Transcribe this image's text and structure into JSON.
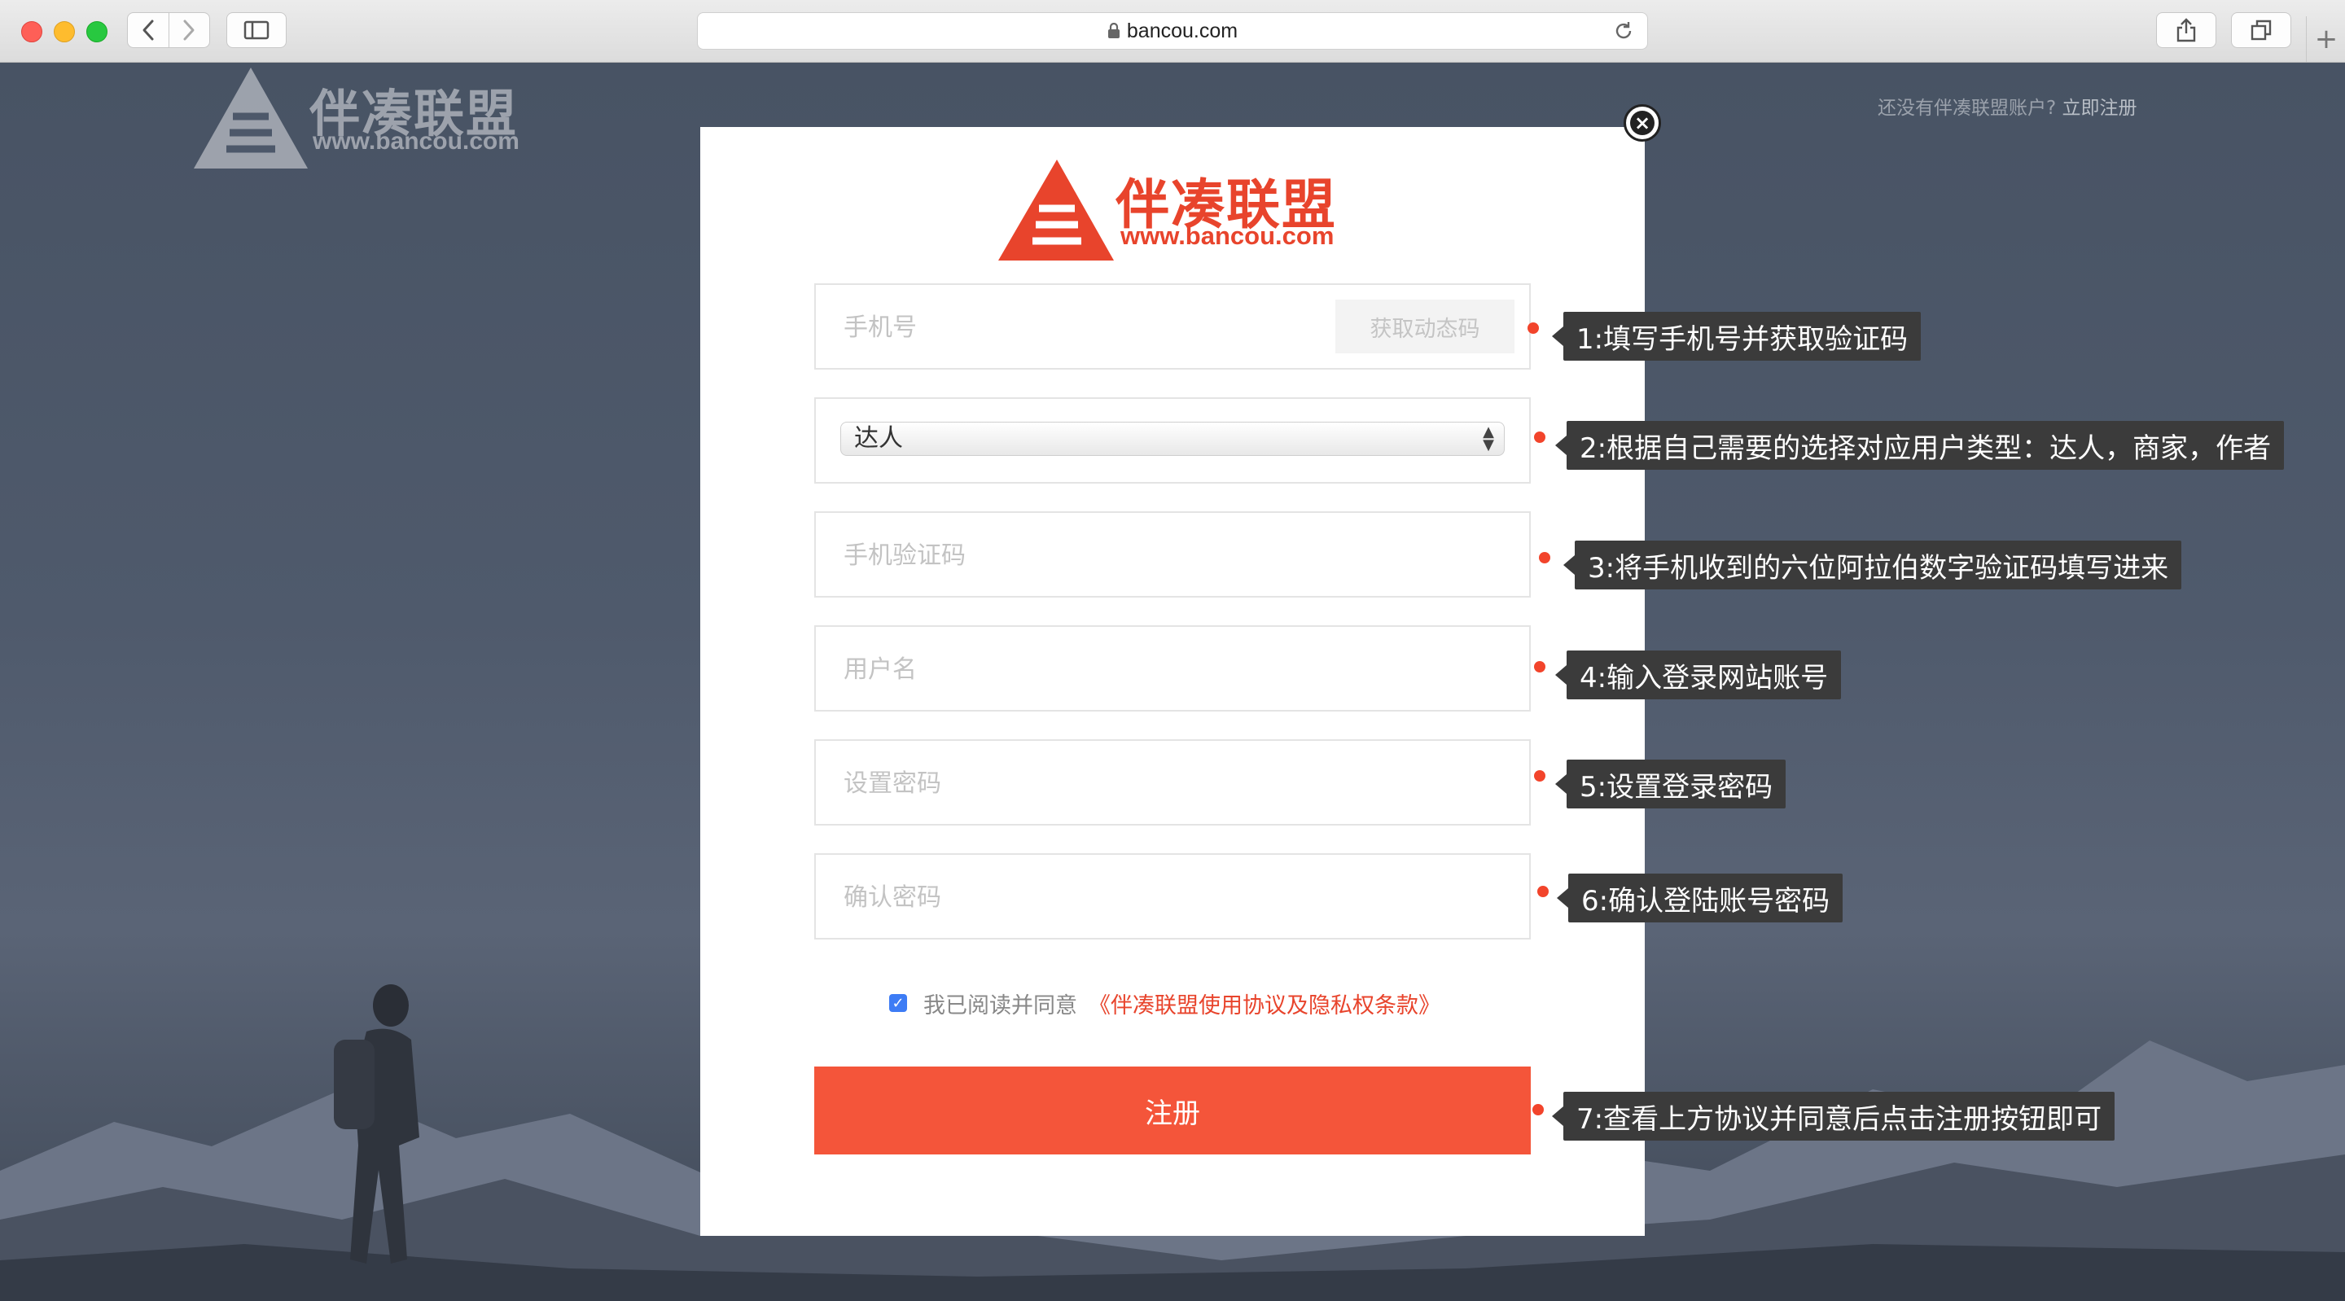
{
  "browser": {
    "url": "bancou.com",
    "icons": {
      "back": "chevron-left-icon",
      "forward": "chevron-right-icon",
      "sidebar": "sidebar-icon",
      "lock": "lock-icon",
      "reload": "reload-icon",
      "share": "share-icon",
      "tabs": "tabs-icon",
      "new_tab": "plus-icon"
    },
    "new_tab_label": "+"
  },
  "background": {
    "logo_text": "伴凑联盟",
    "logo_url": "www.bancou.com",
    "top_link_text": "还没有伴凑联盟账户?",
    "top_link_register": "立即注册"
  },
  "modal": {
    "close_label": "×",
    "logo_text": "伴凑联盟",
    "logo_url": "www.bancou.com",
    "brand_color": "#e8442c",
    "fields": {
      "phone_placeholder": "手机号",
      "get_code_label": "获取动态码",
      "user_type_value": "达人",
      "sms_code_placeholder": "手机验证码",
      "username_placeholder": "用户名",
      "password_placeholder": "设置密码",
      "confirm_password_placeholder": "确认密码"
    },
    "agree_text": "我已阅读并同意",
    "agree_link": "《伴凑联盟使用协议及隐私权条款》",
    "agree_checked": true,
    "submit_label": "注册",
    "submit_color": "#f4553a"
  },
  "annotations": [
    "1:填写手机号并获取验证码",
    "2:根据自己需要的选择对应用户类型：达人，商家，作者",
    "3:将手机收到的六位阿拉伯数字验证码填写进来",
    "4:输入登录网站账号",
    "5:设置登录密码",
    "6:确认登陆账号密码",
    "7:查看上方协议并同意后点击注册按钮即可"
  ]
}
